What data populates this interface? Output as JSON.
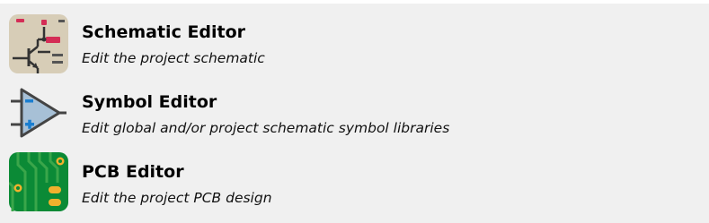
{
  "launcher": {
    "items": [
      {
        "title": "Schematic Editor",
        "description": "Edit the project schematic",
        "icon": "schematic-editor-icon"
      },
      {
        "title": "Symbol Editor",
        "description": "Edit global and/or project schematic symbol libraries",
        "icon": "symbol-editor-icon"
      },
      {
        "title": "PCB Editor",
        "description": "Edit the project PCB design",
        "icon": "pcb-editor-icon"
      }
    ]
  },
  "colors": {
    "panel_background": "#f0f0f0",
    "schematic_icon_bg": "#d7cdb7",
    "schematic_accent": "#d42d56",
    "symbol_icon_fill": "#a7c0d6",
    "symbol_accent": "#1a7ed0",
    "pcb_icon_bg": "#0b8a36",
    "pcb_pad": "#f2b12d"
  }
}
